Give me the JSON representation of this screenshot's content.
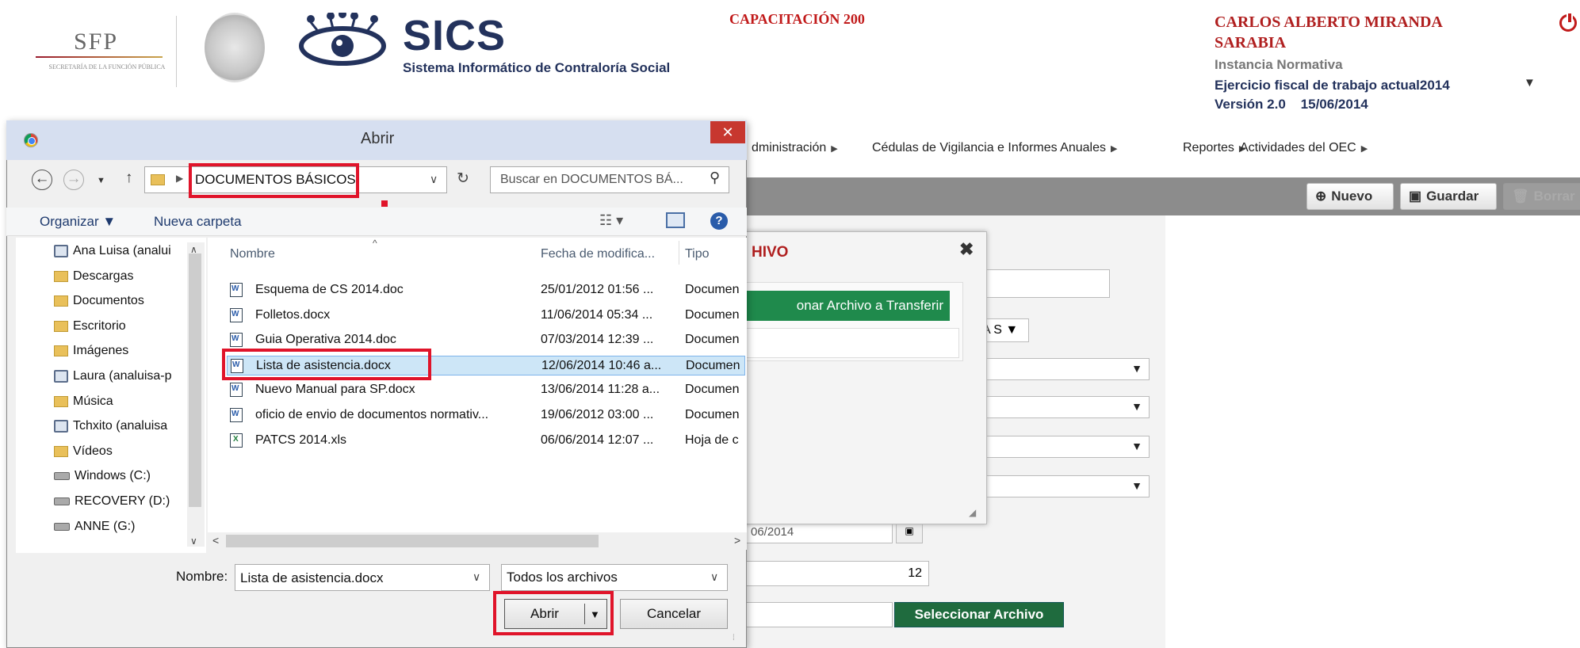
{
  "header": {
    "sfp_logo": "SFP",
    "sfp_subtitle": "SECRETARÍA DE LA FUNCIÓN PÚBLICA",
    "app_name": "SICS",
    "app_full_name": "Sistema Informático de Contraloría Social",
    "environment": "CAPACITACIÓN 200",
    "user_name": "CARLOS ALBERTO MIRANDA SARABIA",
    "instance": "Instancia Normativa",
    "fiscal_year": "Ejercicio fiscal de trabajo actual2014",
    "version": "Versión 2.0    15/06/2014"
  },
  "nav": {
    "items": [
      "dministración",
      "Cédulas de Vigilancia e Informes Anuales",
      "Reportes",
      "Actividades del OEC"
    ]
  },
  "toolbar": {
    "nuevo": "Nuevo",
    "guardar": "Guardar",
    "borrar": "Borrar"
  },
  "background_form": {
    "select_partial": "A S ▼",
    "date_partial": "06/2014",
    "number_value": "12",
    "select_file_button": "Seleccionar Archivo"
  },
  "modal": {
    "title_partial": "HIVO",
    "button_partial": "onar Archivo a Transferir"
  },
  "dialog": {
    "title": "Abrir",
    "address": "DOCUMENTOS BÁSICOS",
    "search_placeholder": "Buscar en DOCUMENTOS BÁ...",
    "organize": "Organizar ▼",
    "new_folder": "Nueva carpeta",
    "columns": {
      "name": "Nombre",
      "date": "Fecha de modifica...",
      "type": "Tipo"
    },
    "tree": [
      {
        "label": "Ana Luisa (analui",
        "icon": "network"
      },
      {
        "label": "Descargas",
        "icon": "folder"
      },
      {
        "label": "Documentos",
        "icon": "folder"
      },
      {
        "label": "Escritorio",
        "icon": "folder"
      },
      {
        "label": "Imágenes",
        "icon": "folder"
      },
      {
        "label": "Laura (analuisa-p",
        "icon": "network"
      },
      {
        "label": "Música",
        "icon": "folder"
      },
      {
        "label": "Tchxito (analuisa",
        "icon": "network"
      },
      {
        "label": "Vídeos",
        "icon": "folder"
      },
      {
        "label": "Windows (C:)",
        "icon": "drive"
      },
      {
        "label": "RECOVERY (D:)",
        "icon": "drive"
      },
      {
        "label": "ANNE (G:)",
        "icon": "drive"
      }
    ],
    "files": [
      {
        "name": "Esquema de CS 2014.doc",
        "date": "25/01/2012 01:56 ...",
        "type": "Documen",
        "icon": "w"
      },
      {
        "name": "Folletos.docx",
        "date": "11/06/2014 05:34 ...",
        "type": "Documen",
        "icon": "w"
      },
      {
        "name": "Guia Operativa 2014.doc",
        "date": "07/03/2014 12:39 ...",
        "type": "Documen",
        "icon": "w"
      },
      {
        "name": "Lista de asistencia.docx",
        "date": "12/06/2014 10:46 a...",
        "type": "Documen",
        "icon": "w"
      },
      {
        "name": "Nuevo Manual para SP.docx",
        "date": "13/06/2014 11:28 a...",
        "type": "Documen",
        "icon": "w"
      },
      {
        "name": "oficio de envio de documentos normativ...",
        "date": "19/06/2012 03:00 ...",
        "type": "Documen",
        "icon": "w"
      },
      {
        "name": "PATCS 2014.xls",
        "date": "06/06/2014 12:07 ...",
        "type": "Hoja de c",
        "icon": "x"
      }
    ],
    "filename_label": "Nombre:",
    "filename_value": "Lista de asistencia.docx",
    "filetype": "Todos los archivos",
    "open_button": "Abrir",
    "cancel_button": "Cancelar"
  }
}
